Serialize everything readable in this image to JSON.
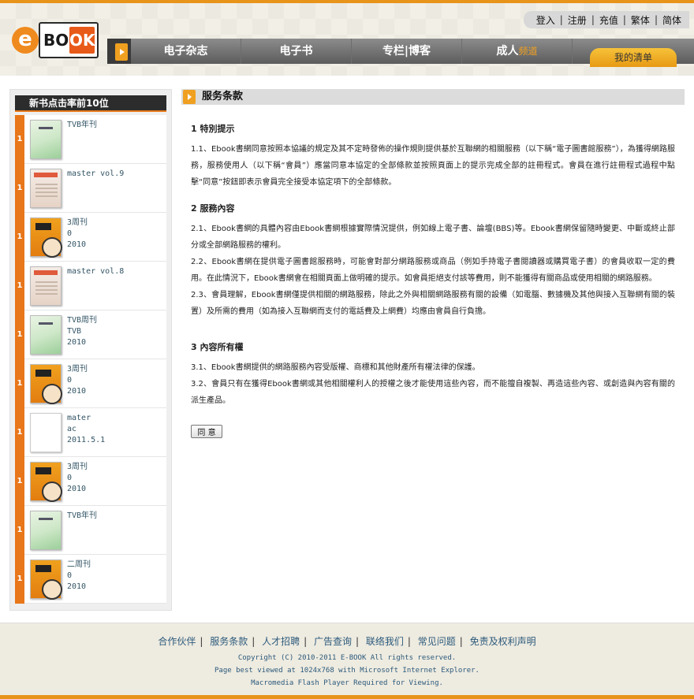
{
  "header": {
    "logo": {
      "e": "e",
      "bo": "BO",
      "ok": "OK"
    },
    "toplinks": [
      "登入",
      "注册",
      "充值",
      "繁体",
      "简体"
    ],
    "nav": [
      "电子杂志",
      "电子书",
      "专栏|博客"
    ],
    "nav_adult": {
      "main": "成人",
      "tag": "频道"
    },
    "my_list": "我的清单"
  },
  "sidebar": {
    "title": "新书点击率前10位",
    "items": [
      {
        "rank": "1",
        "cover": "green",
        "lines": [
          "TVB年刊",
          "",
          ""
        ]
      },
      {
        "rank": "1",
        "cover": "master",
        "lines": [
          "master vol.9",
          "",
          ""
        ]
      },
      {
        "rank": "1",
        "cover": "weekly",
        "lines": [
          "3周刊",
          "0",
          "2010"
        ]
      },
      {
        "rank": "1",
        "cover": "master",
        "lines": [
          "master vol.8",
          "",
          ""
        ]
      },
      {
        "rank": "1",
        "cover": "green",
        "lines": [
          "TVB周刊",
          "TVB",
          "2010"
        ]
      },
      {
        "rank": "1",
        "cover": "weekly",
        "lines": [
          "3周刊",
          "0",
          "2010"
        ]
      },
      {
        "rank": "1",
        "cover": "blank",
        "lines": [
          "mater",
          "ac",
          "2011.5.1"
        ]
      },
      {
        "rank": "1",
        "cover": "weekly",
        "lines": [
          "3周刊",
          "0",
          "2010"
        ]
      },
      {
        "rank": "1",
        "cover": "green",
        "lines": [
          "TVB年刊",
          "",
          ""
        ]
      },
      {
        "rank": "1",
        "cover": "weekly",
        "lines": [
          "二周刊",
          "0",
          "2010"
        ]
      }
    ]
  },
  "main": {
    "title": "服务条款",
    "sections": [
      {
        "heading": "1 特別提示",
        "paras": [
          "1.1、Ebook書網同意按照本協議的規定及其不定時發佈的操作規則提供基於互聯網的相關服務（以下稱“電子圖書館服務”），為獲得網路服務，服務使用人（以下稱“會員”）應當同意本協定的全部條款並按照頁面上的提示完成全部的註冊程式。會員在進行註冊程式過程中點擊“同意”按鈕即表示會員完全接受本協定項下的全部條款。"
        ]
      },
      {
        "heading": "2 服務內容",
        "paras": [
          "2.1、Ebook書網的具體內容由Ebook書網根據實際情況提供，例如線上電子書、論壇(BBS)等。Ebook書網保留隨時變更、中斷或終止部分或全部網路服務的權利。",
          "2.2、Ebook書網在提供電子圖書館服務時，可能會對部分網路服務或商品（例如手持電子書閱讀器或購買電子書）的會員收取一定的費用。在此情況下，Ebook書網會在相關頁面上做明確的提示。如會員拒絕支付該等費用，則不能獲得有關商品或使用相關的網路服務。",
          "2.3、會員理解，Ebook書網僅提供相關的網路服務，除此之外與相關網路服務有關的設備（如電腦、數據機及其他與接入互聯網有關的裝置）及所需的費用（如為接入互聯網而支付的電話費及上網費）均應由會員自行負擔。"
        ]
      },
      {
        "heading": "3 內容所有權",
        "paras": [
          "3.1、Ebook書網提供的網路服務內容受版權、商標和其他財產所有權法律的保護。",
          "3.2、會員只有在獲得Ebook書網或其他相關權利人的授權之後才能使用這些內容，而不能擅自複製、再造這些內容、或創造與內容有關的派生產品。"
        ]
      }
    ],
    "agree_button": "同 意"
  },
  "footer": {
    "links": [
      "合作伙伴",
      "服务条款",
      "人才招聘",
      "广告查询",
      "联络我们",
      "常见问题",
      "免责及权利声明"
    ],
    "copyright": "Copyright (C) 2010-2011 E-BOOK All rights reserved.",
    "best_viewed": "Page best viewed at 1024x768 with Microsoft Internet Explorer.",
    "flash": "Macromedia Flash Player Required for Viewing."
  }
}
